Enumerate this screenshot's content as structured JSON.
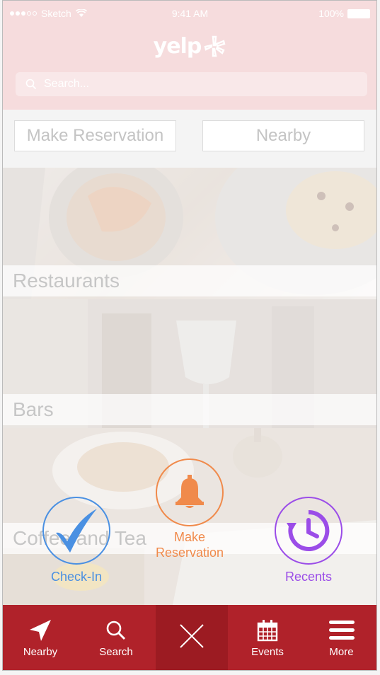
{
  "status_bar": {
    "carrier": "Sketch",
    "time": "9:41 AM",
    "battery": "100%"
  },
  "header": {
    "logo": "yelp",
    "search_placeholder": "Search..."
  },
  "quick_buttons": {
    "make_reservation": "Make Reservation",
    "nearby": "Nearby"
  },
  "categories": [
    {
      "label": "Restaurants"
    },
    {
      "label": "Bars"
    },
    {
      "label": "Coffee and Tea"
    }
  ],
  "actions": {
    "checkin": {
      "label": "Check-In",
      "icon": "checkmark-icon",
      "color": "#4a90e2"
    },
    "reservation": {
      "label": "Make\nReservation",
      "icon": "bell-icon",
      "color": "#f08a4b"
    },
    "recents": {
      "label": "Recents",
      "icon": "clock-history-icon",
      "color": "#9b4de8"
    }
  },
  "tab_bar": {
    "color": "#b0222a",
    "tabs": [
      {
        "label": "Nearby",
        "icon": "location-arrow-icon"
      },
      {
        "label": "Search",
        "icon": "search-icon"
      },
      {
        "label": "",
        "icon": "close-icon"
      },
      {
        "label": "Events",
        "icon": "calendar-icon"
      },
      {
        "label": "More",
        "icon": "menu-icon"
      }
    ]
  }
}
